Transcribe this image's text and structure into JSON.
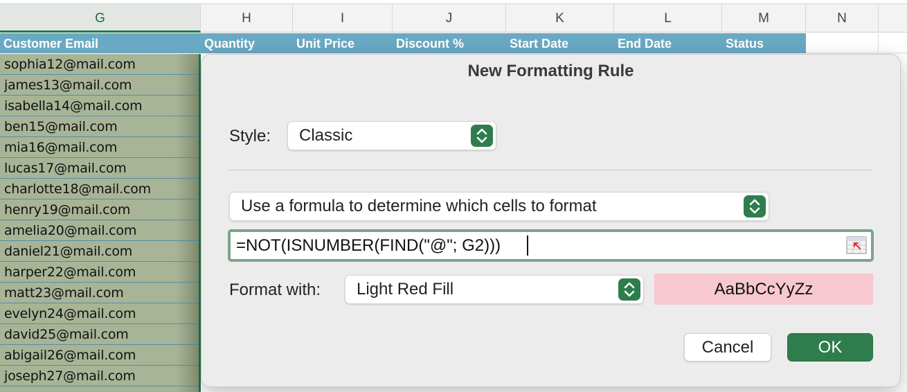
{
  "sheet": {
    "columns": [
      "G",
      "H",
      "I",
      "J",
      "K",
      "L",
      "M",
      "N"
    ],
    "headers": [
      "Customer Email",
      "Quantity",
      "Unit Price",
      "Discount %",
      "Start Date",
      "End Date",
      "Status"
    ],
    "emails": [
      "sophia12@mail.com",
      "james13@mail.com",
      "isabella14@mail.com",
      "ben15@mail.com",
      "mia16@mail.com",
      "lucas17@mail.com",
      "charlotte18@mail.com",
      "henry19@mail.com",
      "amelia20@mail.com",
      "daniel21@mail.com",
      "harper22@mail.com",
      "matt23@mail.com",
      "evelyn24@mail.com",
      "david25@mail.com",
      "abigail26@mail.com",
      "joseph27@mail.com"
    ],
    "colors": {
      "header_fill": "#6aa9c4",
      "email_fill": "#a8b496",
      "selection": "#1e7a45"
    }
  },
  "dialog": {
    "title": "New Formatting Rule",
    "style_label": "Style:",
    "style_value": "Classic",
    "rule_type": "Use a formula to determine which cells to format",
    "formula": "=NOT(ISNUMBER(FIND(\"@\"; G2)))",
    "format_label": "Format with:",
    "format_value": "Light Red Fill",
    "preview_text": "AaBbCcYyZz",
    "cancel_label": "Cancel",
    "ok_label": "OK",
    "colors": {
      "accent": "#2f7d4c",
      "preview_fill": "#f7c8cf"
    }
  }
}
